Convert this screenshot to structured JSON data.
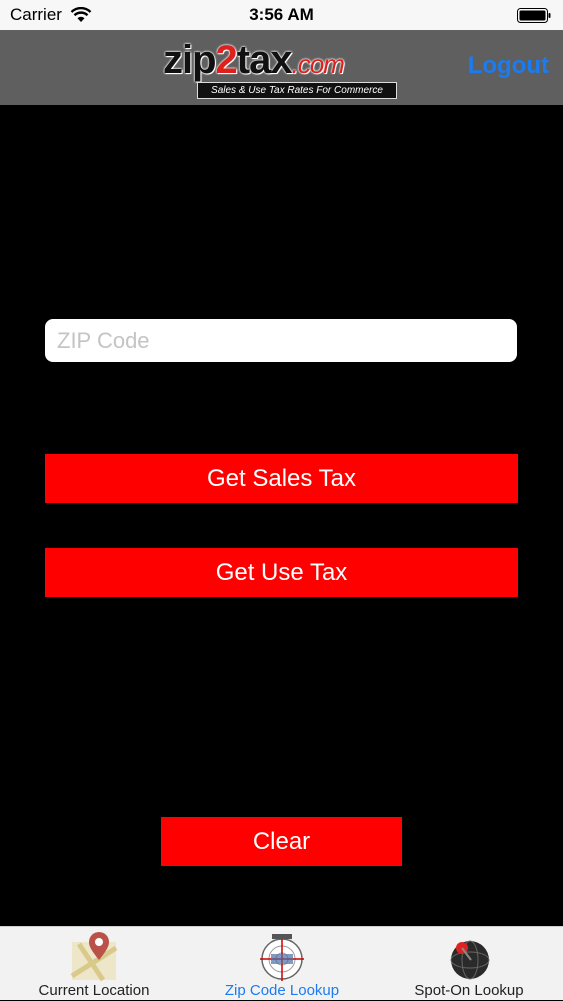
{
  "status_bar": {
    "carrier": "Carrier",
    "time": "3:56 AM"
  },
  "header": {
    "logo_main_part1": "zip",
    "logo_main_part2": "2",
    "logo_main_part3": "tax",
    "logo_dotcom": ".com",
    "logo_tagline": "Sales & Use Tax Rates For Commerce",
    "logout_label": "Logout"
  },
  "form": {
    "zip_placeholder": "ZIP Code",
    "zip_value": "",
    "sales_tax_label": "Get Sales Tax",
    "use_tax_label": "Get Use Tax",
    "clear_label": "Clear"
  },
  "tabs": [
    {
      "label": "Current Location",
      "icon": "map-pin-icon"
    },
    {
      "label": "Zip Code Lookup",
      "icon": "zip-code-target-icon"
    },
    {
      "label": "Spot-On Lookup",
      "icon": "globe-pin-icon"
    }
  ],
  "colors": {
    "accent": "#1a7cf0",
    "button_red": "#ff0000",
    "nav_bg": "#5f5f5f",
    "page_bg": "#000000"
  }
}
